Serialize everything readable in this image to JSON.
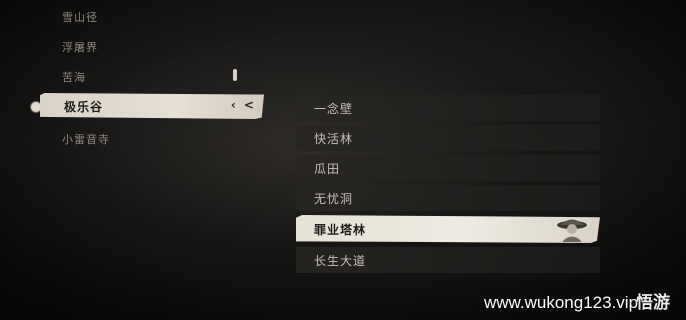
{
  "regions": {
    "items": [
      {
        "label": "雪山径"
      },
      {
        "label": "浮屠界"
      },
      {
        "label": "苦海"
      },
      {
        "label": "极乐谷",
        "selected": true
      },
      {
        "label": "小雷音寺"
      }
    ],
    "selected_chevron": "‹ <"
  },
  "locations": {
    "items": [
      {
        "label": "一念壁"
      },
      {
        "label": "快活林"
      },
      {
        "label": "瓜田"
      },
      {
        "label": "无忧洞"
      },
      {
        "label": "罪业塔林",
        "selected": true
      },
      {
        "label": "长生大道"
      }
    ]
  },
  "watermark": {
    "text": "www.wukong123.vip",
    "logo": "悟游"
  },
  "colors": {
    "selected_bg": "#e6e0d4",
    "panel_bg": "#1e1d1b",
    "text": "#c9c4ba"
  }
}
